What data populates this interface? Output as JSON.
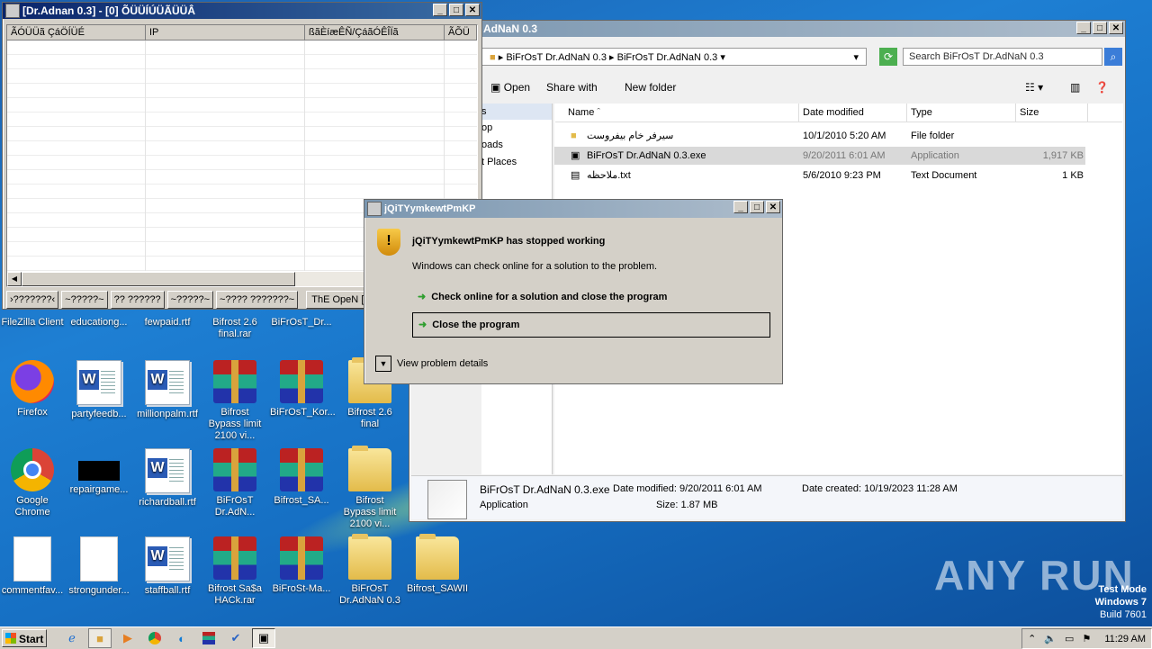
{
  "adnan_window": {
    "title": "[Dr.Adnan 0.3]   - [0] ÕÜÜÍÚÜÃÜÜÂ",
    "columns": [
      "ÃÓÜÜã ÇáÖÍÜÉ",
      "IP",
      "ßãÈíæÊÑ/ÇáãÓÊÎÏã",
      "ÃÕÜ"
    ],
    "buttons": [
      "›???????‹",
      "~?????~",
      "?? ??????",
      "~?????~",
      "~???? ???????~",
      "ThE OpeN [PorT]"
    ]
  },
  "explorer": {
    "title": "AdNaN 0.3",
    "breadcrumb": [
      "BiFrOsT Dr.AdNaN 0.3",
      "BiFrOsT Dr.AdNaN 0.3"
    ],
    "search_placeholder": "Search BiFrOsT Dr.AdNaN 0.3",
    "toolbar": {
      "open": "Open",
      "share": "Share with",
      "new_folder": "New folder"
    },
    "sidebar_items": [
      "s",
      "op",
      "oads",
      "t Places"
    ],
    "columns": {
      "name": "Name",
      "date": "Date modified",
      "type": "Type",
      "size": "Size"
    },
    "files": [
      {
        "name": "سيرفر خام بيفروست",
        "date": "10/1/2010 5:20 AM",
        "type": "File folder",
        "size": ""
      },
      {
        "name": "BiFrOsT Dr.AdNaN 0.3.exe",
        "date": "9/20/2011 6:01 AM",
        "type": "Application",
        "size": "1,917 KB"
      },
      {
        "name": "ملاحظه.txt",
        "date": "5/6/2010 9:23 PM",
        "type": "Text Document",
        "size": "1 KB"
      }
    ],
    "details": {
      "filename": "BiFrOsT Dr.AdNaN 0.3.exe",
      "date_modified_label": "Date modified:",
      "date_modified": "9/20/2011 6:01 AM",
      "date_created_label": "Date created:",
      "date_created": "10/19/2023 11:28 AM",
      "type": "Application",
      "size_label": "Size:",
      "size": "1.87 MB"
    }
  },
  "dialog": {
    "title": "jQiTYymkewtPmKP",
    "heading": "jQiTYymkewtPmKP has stopped working",
    "message": "Windows can check online for a solution to the problem.",
    "option1": "Check online for a solution and close the program",
    "option2": "Close the program",
    "details": "View problem details"
  },
  "desktop_icons": [
    {
      "label": "FileZilla Client"
    },
    {
      "label": "educationg..."
    },
    {
      "label": "fewpaid.rtf"
    },
    {
      "label": "Bifrost 2.6 final.rar"
    },
    {
      "label": "BiFrOsT_Dr..."
    },
    {
      "label": "Firefox"
    },
    {
      "label": "partyfeedb..."
    },
    {
      "label": "millionpalm.rtf"
    },
    {
      "label": "Bifrost Bypass limit 2100 vi..."
    },
    {
      "label": "BiFrOsT_Kor..."
    },
    {
      "label": "Bifrost 2.6 final"
    },
    {
      "label": "Google Chrome"
    },
    {
      "label": "repairgame..."
    },
    {
      "label": "richardball.rtf"
    },
    {
      "label": "BiFrOsT Dr.AdN..."
    },
    {
      "label": "Bifrost_SA..."
    },
    {
      "label": "Bifrost Bypass limit 2100 vi..."
    },
    {
      "label": "commentfav..."
    },
    {
      "label": "strongunder..."
    },
    {
      "label": "staffball.rtf"
    },
    {
      "label": "Bifrost Sa$a HACk.rar"
    },
    {
      "label": "BiFroSt-Ma..."
    },
    {
      "label": "BiFrOsT Dr.AdNaN 0.3"
    },
    {
      "label": "Bifrost_SAWII"
    }
  ],
  "watermark": {
    "text": "ANY RUN",
    "test_mode": "Test Mode",
    "os": "Windows 7",
    "build": "Build 7601"
  },
  "taskbar": {
    "start": "Start",
    "clock": "11:29 AM"
  }
}
